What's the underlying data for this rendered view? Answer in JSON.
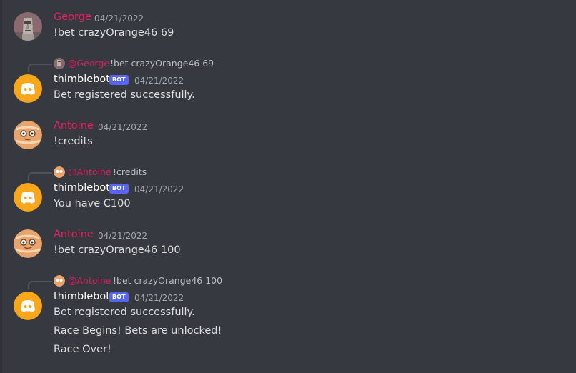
{
  "colors": {
    "background": "#36393f",
    "author_mention": "#e91e63",
    "bot_tag": "#5865f2",
    "bot_avatar": "#faa61a"
  },
  "messages": [
    {
      "author": "George",
      "timestamp": "04/21/2022",
      "avatar_icon": "moai-statue-icon",
      "lines": [
        "!bet crazyOrange46 69"
      ]
    },
    {
      "reply_to": {
        "mention": "@George",
        "text": "!bet crazyOrange46 69",
        "avatar_icon": "moai-statue-icon"
      },
      "author": "thimblebot",
      "bot_tag": "BOT",
      "timestamp": "04/21/2022",
      "avatar_icon": "discord-logo-icon",
      "lines": [
        "Bet registered successfully."
      ]
    },
    {
      "author": "Antoine",
      "timestamp": "04/21/2022",
      "avatar_icon": "cookie-face-icon",
      "lines": [
        "!credits"
      ]
    },
    {
      "reply_to": {
        "mention": "@Antoine",
        "text": "!credits",
        "avatar_icon": "cookie-face-icon"
      },
      "author": "thimblebot",
      "bot_tag": "BOT",
      "timestamp": "04/21/2022",
      "avatar_icon": "discord-logo-icon",
      "lines": [
        "You have C100"
      ]
    },
    {
      "author": "Antoine",
      "timestamp": "04/21/2022",
      "avatar_icon": "cookie-face-icon",
      "lines": [
        "!bet crazyOrange46 100"
      ]
    },
    {
      "reply_to": {
        "mention": "@Antoine",
        "text": "!bet crazyOrange46 100",
        "avatar_icon": "cookie-face-icon"
      },
      "author": "thimblebot",
      "bot_tag": "BOT",
      "timestamp": "04/21/2022",
      "avatar_icon": "discord-logo-icon",
      "lines": [
        "Bet registered successfully.",
        "Race Begins! Bets are unlocked!",
        "Race Over!"
      ]
    }
  ]
}
